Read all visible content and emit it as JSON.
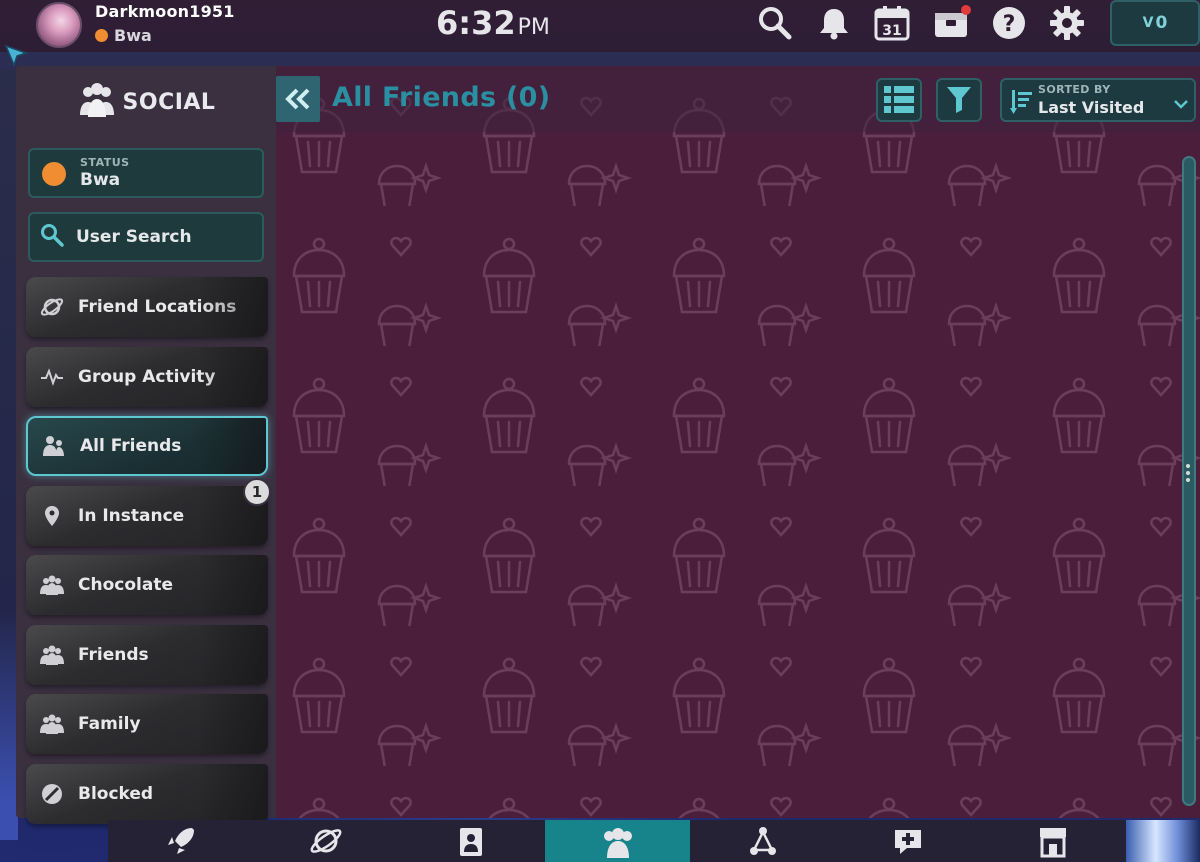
{
  "topbar": {
    "username": "Darkmoon1951",
    "user_status": "Bwa",
    "time": "6:32",
    "ampm": "PM",
    "credits": "0",
    "credit_prefix": "V",
    "calendar_day": "31"
  },
  "sidebar": {
    "title": "SOCIAL",
    "status_label": "STATUS",
    "status_value": "Bwa",
    "search_label": "User Search",
    "items": [
      {
        "label": "Friend Locations",
        "icon": "planet-icon"
      },
      {
        "label": "Group Activity",
        "icon": "activity-icon"
      },
      {
        "label": "All Friends",
        "icon": "friends-icon",
        "active": true
      },
      {
        "label": "In Instance",
        "icon": "location-pin-icon"
      },
      {
        "label": "Chocolate",
        "icon": "group-icon"
      },
      {
        "label": "Friends",
        "icon": "group-icon"
      },
      {
        "label": "Family",
        "icon": "group-icon"
      },
      {
        "label": "Blocked",
        "icon": "blocked-icon"
      }
    ],
    "in_instance_badge": "1"
  },
  "main": {
    "title": "All Friends (0)",
    "sort_label": "SORTED BY",
    "sort_value": "Last Visited"
  },
  "colors": {
    "accent": "#2a8fa0",
    "panel_bg": "#3a3040",
    "main_bg": "#4b1f3c",
    "button_bg": "#1d3a40",
    "status_orange": "#f08c32",
    "active_border": "#5ec7d0",
    "dock_active": "#17838a"
  },
  "dock": {
    "items": [
      "rocket-icon",
      "planet-icon",
      "avatar-card-icon",
      "social-icon",
      "network-icon",
      "chat-add-icon",
      "shop-icon"
    ],
    "active_index": 3
  }
}
